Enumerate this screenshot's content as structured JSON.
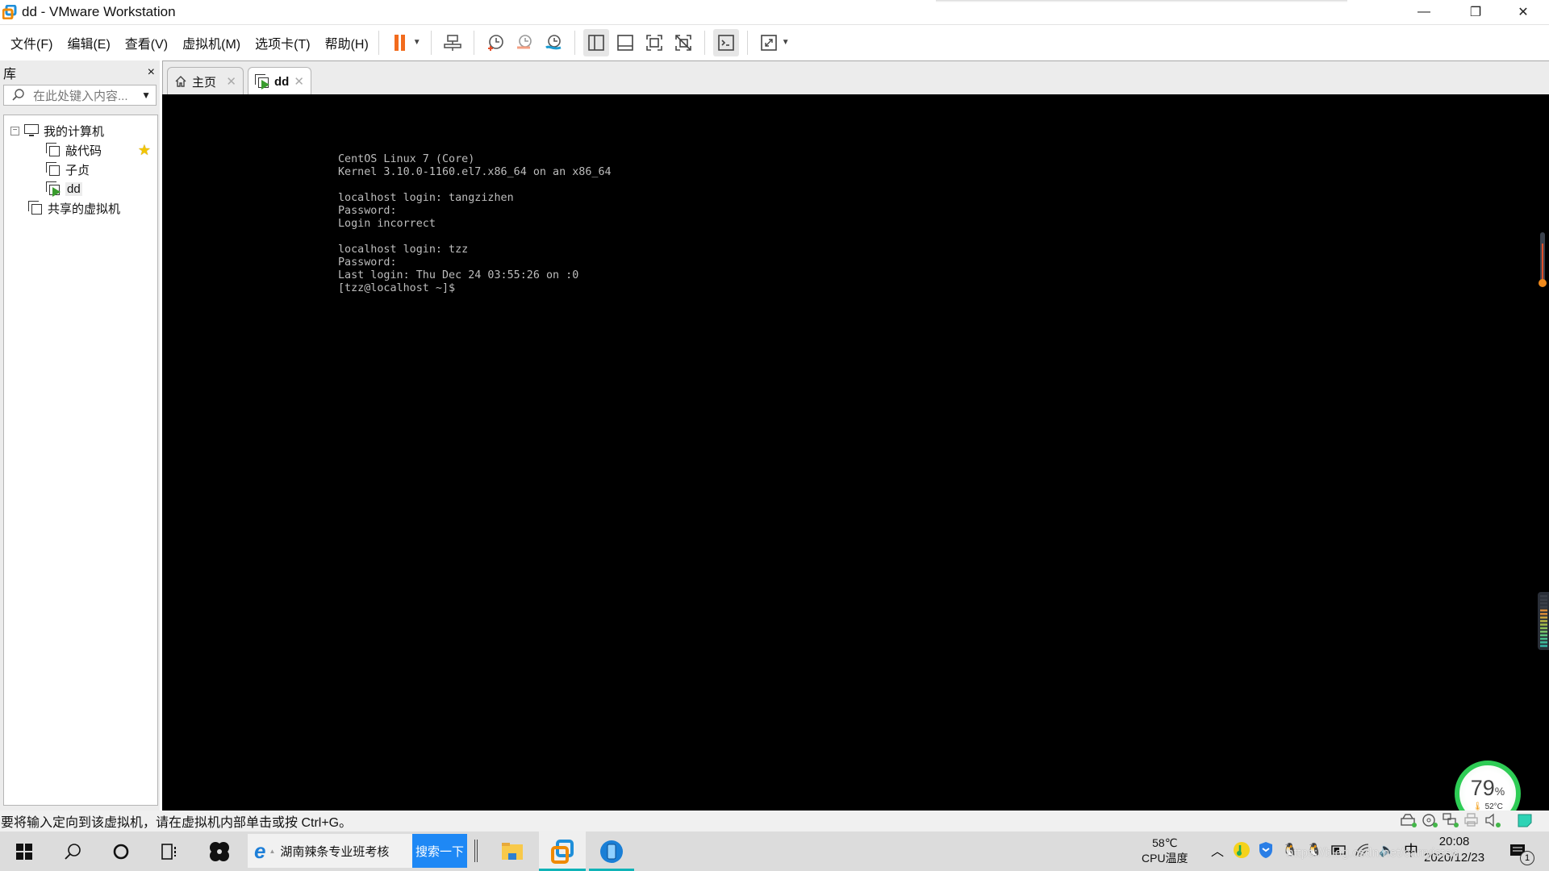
{
  "window": {
    "title": "dd - VMware Workstation",
    "controls": {
      "minimize": "—",
      "restore": "❐",
      "close": "✕"
    }
  },
  "menu": [
    "文件(F)",
    "编辑(E)",
    "查看(V)",
    "虚拟机(M)",
    "选项卡(T)",
    "帮助(H)"
  ],
  "toolbar": {
    "icons": [
      "pause-icon",
      "send-ctrl-alt-del-icon",
      "snapshot-take-icon",
      "snapshot-revert-icon",
      "snapshot-manager-icon",
      "show-library-icon",
      "thumbnail-bar-icon",
      "full-screen-icon",
      "unity-icon",
      "console-view-icon",
      "stretch-guest-icon"
    ],
    "accent": "#f26b1d"
  },
  "library": {
    "title": "库",
    "close": "×",
    "search_placeholder": "在此处键入内容...",
    "tree": {
      "root": "我的计算机",
      "vms": [
        {
          "name": "敲代码",
          "favorite": true
        },
        {
          "name": "子贞",
          "favorite": false
        },
        {
          "name": "dd",
          "favorite": false,
          "running": true,
          "selected": true
        }
      ],
      "shared": "共享的虚拟机"
    }
  },
  "tabs": [
    {
      "label": "主页",
      "icon": "home-icon",
      "active": false
    },
    {
      "label": "dd",
      "icon": "vm-running-icon",
      "active": true
    }
  ],
  "terminal": {
    "lines": [
      "CentOS Linux 7 (Core)",
      "Kernel 3.10.0-1160.el7.x86_64 on an x86_64",
      "",
      "localhost login: tangzizhen",
      "Password:",
      "Login incorrect",
      "",
      "localhost login: tzz",
      "Password:",
      "Last login: Thu Dec 24 03:55:26 on :0",
      "[tzz@localhost ~]$"
    ]
  },
  "status": {
    "message": "要将输入定向到该虚拟机，请在虚拟机内部单击或按 Ctrl+G。",
    "device_icons": [
      "hard-disk-icon",
      "cd-dvd-icon",
      "network-adapter-icon",
      "printer-icon",
      "sound-card-icon",
      "message-log-icon"
    ]
  },
  "gauge": {
    "percent": "79",
    "percent_unit": "%",
    "temperature": "52°C"
  },
  "taskbar": {
    "search_text": "湖南辣条专业班考核",
    "search_button": "搜索一下",
    "cpu_temp_value": "58℃",
    "cpu_temp_label": "CPU温度",
    "ime": "中",
    "time": "20:08",
    "date": "2020/12/23",
    "notification_count": "1",
    "watermark": "https://blog.csdn.net/carryisten"
  }
}
